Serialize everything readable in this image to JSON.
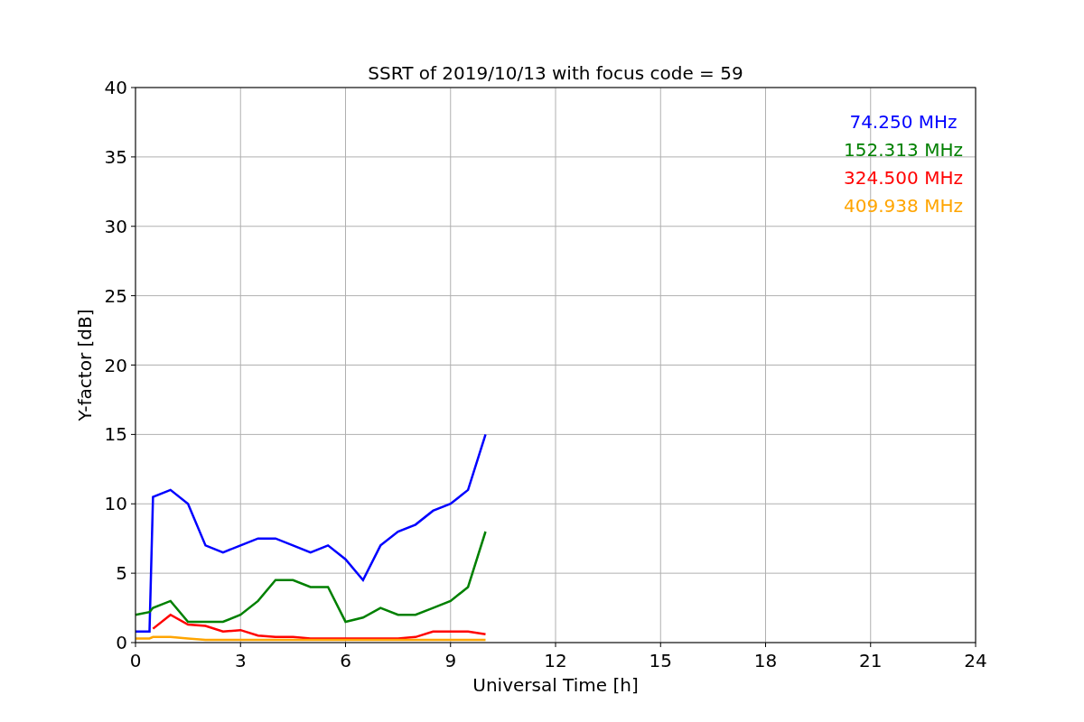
{
  "chart_data": {
    "type": "line",
    "title": "SSRT of 2019/10/13 with focus code = 59",
    "xlabel": "Universal Time [h]",
    "ylabel": "Y-factor [dB]",
    "x": [
      0,
      0.4,
      0.5,
      1,
      1.5,
      2,
      2.5,
      3,
      3.5,
      4,
      4.5,
      5,
      5.5,
      6,
      6.5,
      7,
      7.5,
      8,
      8.5,
      9,
      9.5,
      10
    ],
    "series": [
      {
        "name": "74.250 MHz",
        "color": "#0000ff",
        "values": [
          0.8,
          0.8,
          10.5,
          11,
          10,
          7,
          6.5,
          7,
          7.5,
          7.5,
          7,
          6.5,
          7,
          6,
          4.5,
          7,
          8,
          8.5,
          9.5,
          10,
          11,
          15
        ]
      },
      {
        "name": "152.313 MHz",
        "color": "#008000",
        "values": [
          2,
          2.2,
          2.5,
          3,
          1.5,
          1.5,
          1.5,
          2,
          3,
          4.5,
          4.5,
          4,
          4,
          1.5,
          1.8,
          2.5,
          2,
          2,
          2.5,
          3,
          4,
          8
        ]
      },
      {
        "name": "324.500 MHz",
        "color": "#ff0000",
        "values": [
          null,
          null,
          1,
          2,
          1.3,
          1.2,
          0.8,
          0.9,
          0.5,
          0.4,
          0.4,
          0.3,
          0.3,
          0.3,
          0.3,
          0.3,
          0.3,
          0.4,
          0.8,
          0.8,
          0.8,
          0.6
        ]
      },
      {
        "name": "409.938 MHz",
        "color": "#ffa500",
        "values": [
          0.3,
          0.3,
          0.4,
          0.4,
          0.3,
          0.2,
          0.2,
          0.2,
          0.2,
          0.2,
          0.2,
          0.2,
          0.2,
          0.2,
          0.2,
          0.2,
          0.2,
          0.2,
          0.2,
          0.2,
          0.2,
          0.2
        ]
      }
    ],
    "grid": true,
    "xlim": [
      0,
      24
    ],
    "ylim": [
      0,
      40
    ],
    "xticks": [
      0,
      3,
      6,
      9,
      12,
      15,
      18,
      21,
      24
    ],
    "yticks": [
      0,
      5,
      10,
      15,
      20,
      25,
      30,
      35,
      40
    ]
  }
}
